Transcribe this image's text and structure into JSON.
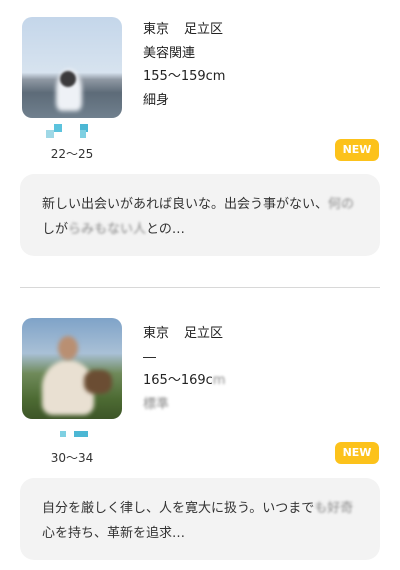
{
  "profiles": [
    {
      "prefecture": "東京",
      "city": "足立区",
      "occupation": "美容関連",
      "height": "155〜159cm",
      "body": "細身",
      "age": "22〜25",
      "badge": "NEW",
      "badge_color": "#fcc21b",
      "message_visible": "新しい出会いがあれば良いな。出会う事がない、",
      "message_blurred": "何の",
      "message_line2_pre": "しが",
      "message_line2_blurred": "らみもない人",
      "message_line2_post": "との…"
    },
    {
      "prefecture": "東京",
      "city": "足立区",
      "occupation": "―",
      "height": "165〜169c",
      "height_blurred": "m",
      "body": "標準",
      "age": "30〜34",
      "badge": "NEW",
      "badge_color": "#fcc21b",
      "message_visible": "自分を厳しく律し、人を寛大に扱う。いつまで",
      "message_blurred": "も好奇",
      "message_line2_pre": "心を持ち、革新を追求…",
      "message_line2_blurred": "",
      "message_line2_post": ""
    }
  ]
}
